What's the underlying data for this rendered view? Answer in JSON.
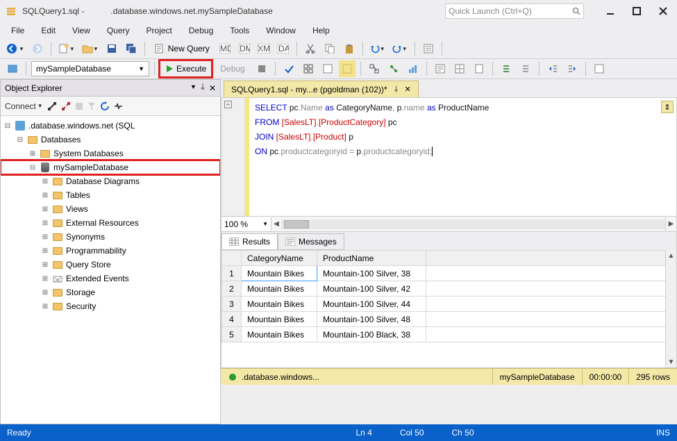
{
  "title": {
    "file": "SQLQuery1.sql -",
    "server": ".database.windows.net.mySampleDatabase"
  },
  "quick_launch": {
    "placeholder": "Quick Launch (Ctrl+Q)"
  },
  "menu": [
    "File",
    "Edit",
    "View",
    "Query",
    "Project",
    "Debug",
    "Tools",
    "Window",
    "Help"
  ],
  "toolbar": {
    "new_query": "New Query",
    "db_combo": "mySampleDatabase",
    "execute": "Execute",
    "debug": "Debug"
  },
  "explorer": {
    "title": "Object Explorer",
    "connect": "Connect",
    "server_label": ".database.windows.net (SQL",
    "databases": "Databases",
    "sys_db": "System Databases",
    "sample_db": "mySampleDatabase",
    "children": [
      "Database Diagrams",
      "Tables",
      "Views",
      "External Resources",
      "Synonyms",
      "Programmability",
      "Query Store",
      "Extended Events",
      "Storage",
      "Security"
    ]
  },
  "doc_tab": {
    "label": "SQLQuery1.sql - my...e (pgoldman (102))*"
  },
  "sql": {
    "line1_a": "SELECT",
    "line1_b": " pc",
    "line1_c": ".Name ",
    "line1_d": "as",
    "line1_e": " CategoryName",
    "line1_f": ",",
    "line1_g": " p",
    "line1_h": ".name ",
    "line1_i": "as",
    "line1_j": " ProductName",
    "line2_a": "FROM",
    "line2_b": " [SalesLT]",
    "line2_c": ".",
    "line2_d": "[ProductCategory]",
    "line2_e": " pc",
    "line3_a": "JOIN",
    "line3_b": " [SalesLT]",
    "line3_c": ".",
    "line3_d": "[Product]",
    "line3_e": " p",
    "line4_a": "ON",
    "line4_b": " pc",
    "line4_c": ".productcategoryid ",
    "line4_d": "=",
    "line4_e": " p",
    "line4_f": ".productcategoryid",
    "line4_g": ";"
  },
  "zoom": "100 %",
  "results": {
    "tab_results": "Results",
    "tab_messages": "Messages",
    "columns": [
      "CategoryName",
      "ProductName"
    ],
    "rows": [
      {
        "n": "1",
        "cat": "Mountain Bikes",
        "prod": "Mountain-100 Silver, 38"
      },
      {
        "n": "2",
        "cat": "Mountain Bikes",
        "prod": "Mountain-100 Silver, 42"
      },
      {
        "n": "3",
        "cat": "Mountain Bikes",
        "prod": "Mountain-100 Silver, 44"
      },
      {
        "n": "4",
        "cat": "Mountain Bikes",
        "prod": "Mountain-100 Silver, 48"
      },
      {
        "n": "5",
        "cat": "Mountain Bikes",
        "prod": "Mountain-100 Black, 38"
      }
    ]
  },
  "editor_status": {
    "server": ".database.windows...",
    "db": "mySampleDatabase",
    "time": "00:00:00",
    "rows": "295 rows"
  },
  "status": {
    "ready": "Ready",
    "ln": "Ln 4",
    "col": "Col 50",
    "ch": "Ch 50",
    "ins": "INS"
  }
}
